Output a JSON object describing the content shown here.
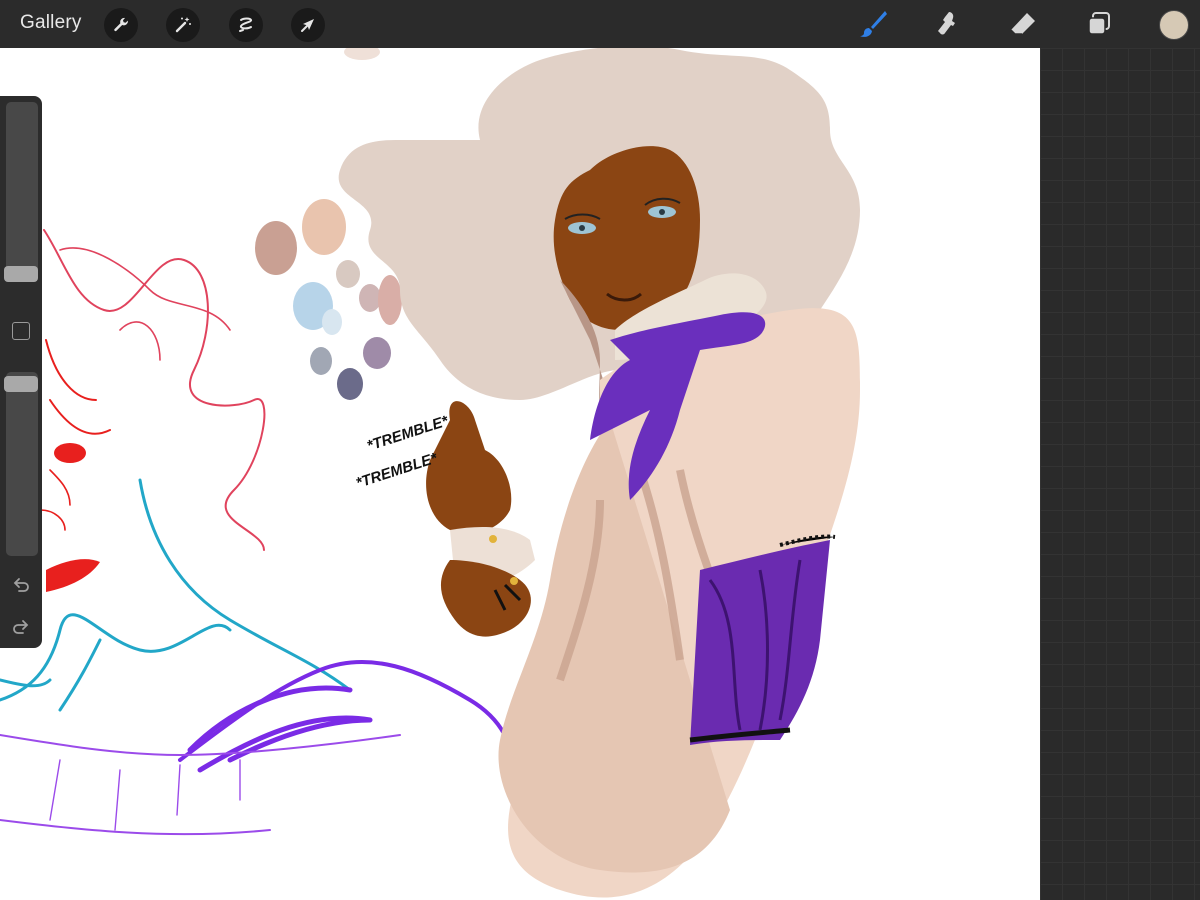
{
  "toolbar": {
    "gallery_label": "Gallery",
    "left_tools": [
      "wrench-icon",
      "magic-wand-icon",
      "selection-icon",
      "transform-arrow-icon"
    ],
    "right_tools": [
      "brush-icon",
      "smudge-icon",
      "eraser-icon",
      "layers-icon"
    ],
    "active_tool": "brush-icon",
    "current_color": "#d6c9b5"
  },
  "sidebar": {
    "brush_size_level": 0.1,
    "opacity_level": 0.95,
    "controls": [
      "modify-button",
      "undo-icon",
      "redo-icon"
    ]
  },
  "canvas": {
    "palette_colors": [
      "#e9c4ae",
      "#c9a093",
      "#d8c9c1",
      "#b7d4e9",
      "#d8e6f0",
      "#cfb5b5",
      "#d9aea7",
      "#a1a7b4",
      "#9f8ba8",
      "#6b6b8a"
    ],
    "caption_line1": "*TREMBLE*",
    "caption_line2": "*TREMBLE*"
  }
}
